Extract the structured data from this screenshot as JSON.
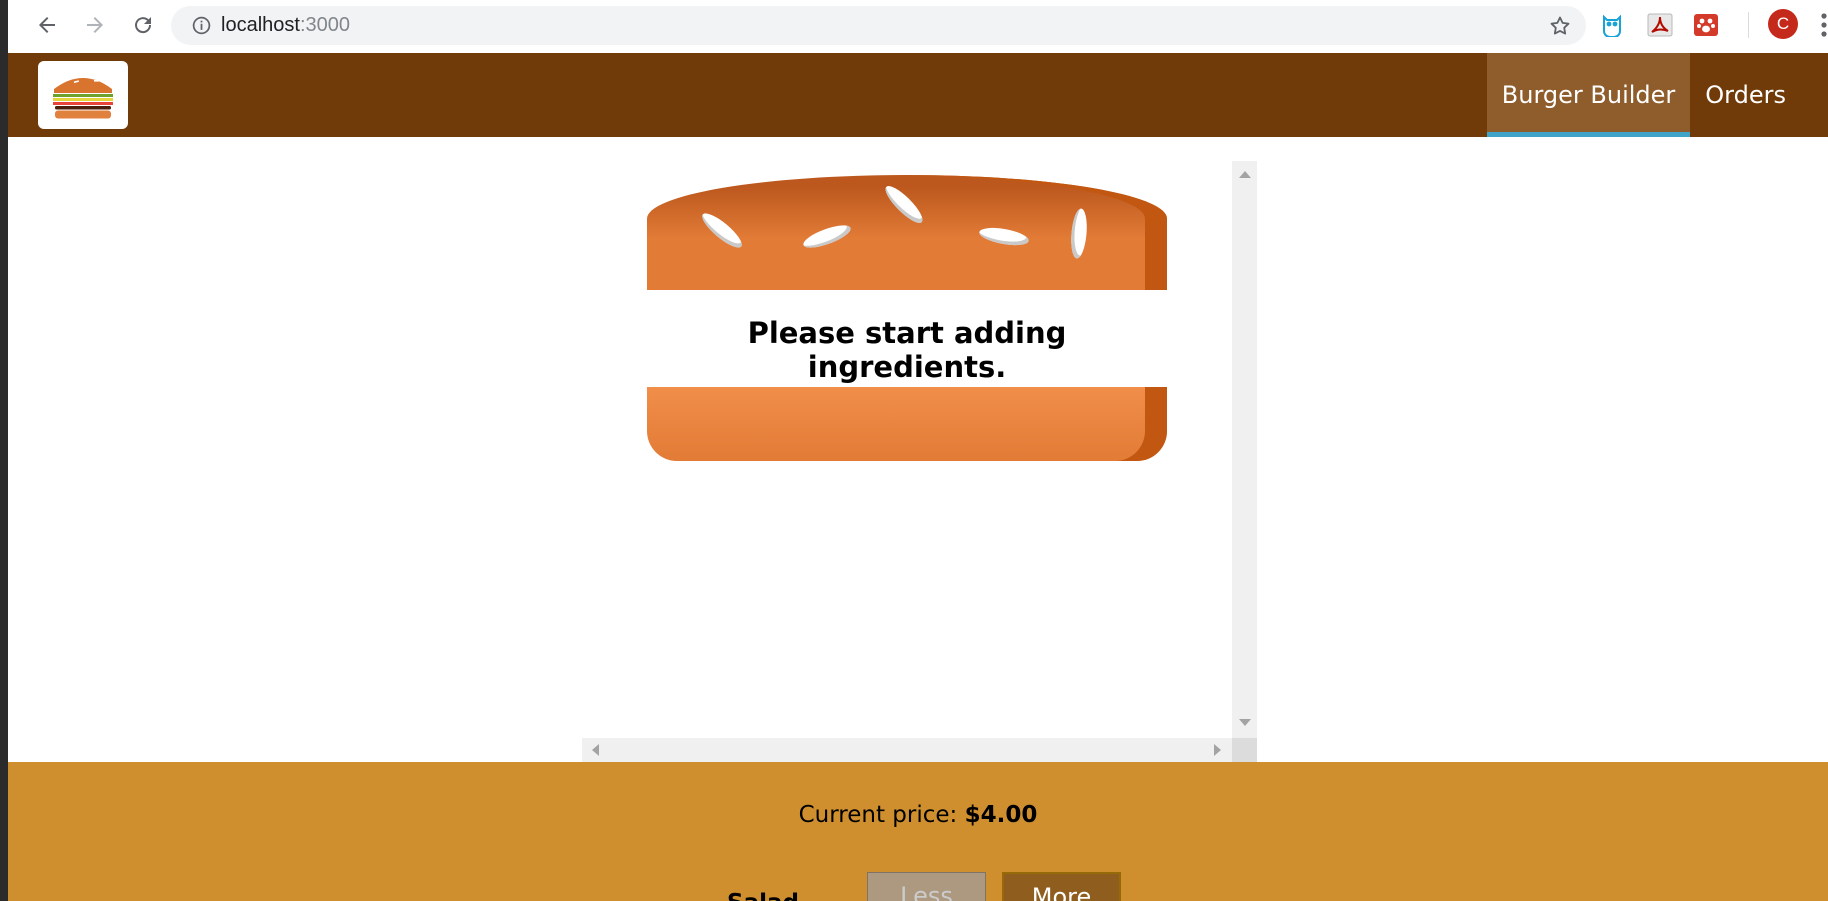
{
  "browser": {
    "url_host": "localhost",
    "url_port": ":3000",
    "profile_initial": "C"
  },
  "toolbar": {
    "nav": [
      {
        "label": "Burger Builder",
        "active": true
      },
      {
        "label": "Orders",
        "active": false
      }
    ]
  },
  "burger": {
    "empty_message": "Please start adding ingredients."
  },
  "controls": {
    "price_label": "Current price: ",
    "price_value": "$4.00",
    "rows": [
      {
        "label": "Salad",
        "less_label": "Less",
        "more_label": "More",
        "less_disabled": true
      }
    ]
  },
  "colors": {
    "toolbar": "#703b09",
    "active_nav": "#8f5c2c",
    "active_indicator": "#40a4c8",
    "controls_bg": "#cf8f2e",
    "bread": "#e27b36"
  }
}
